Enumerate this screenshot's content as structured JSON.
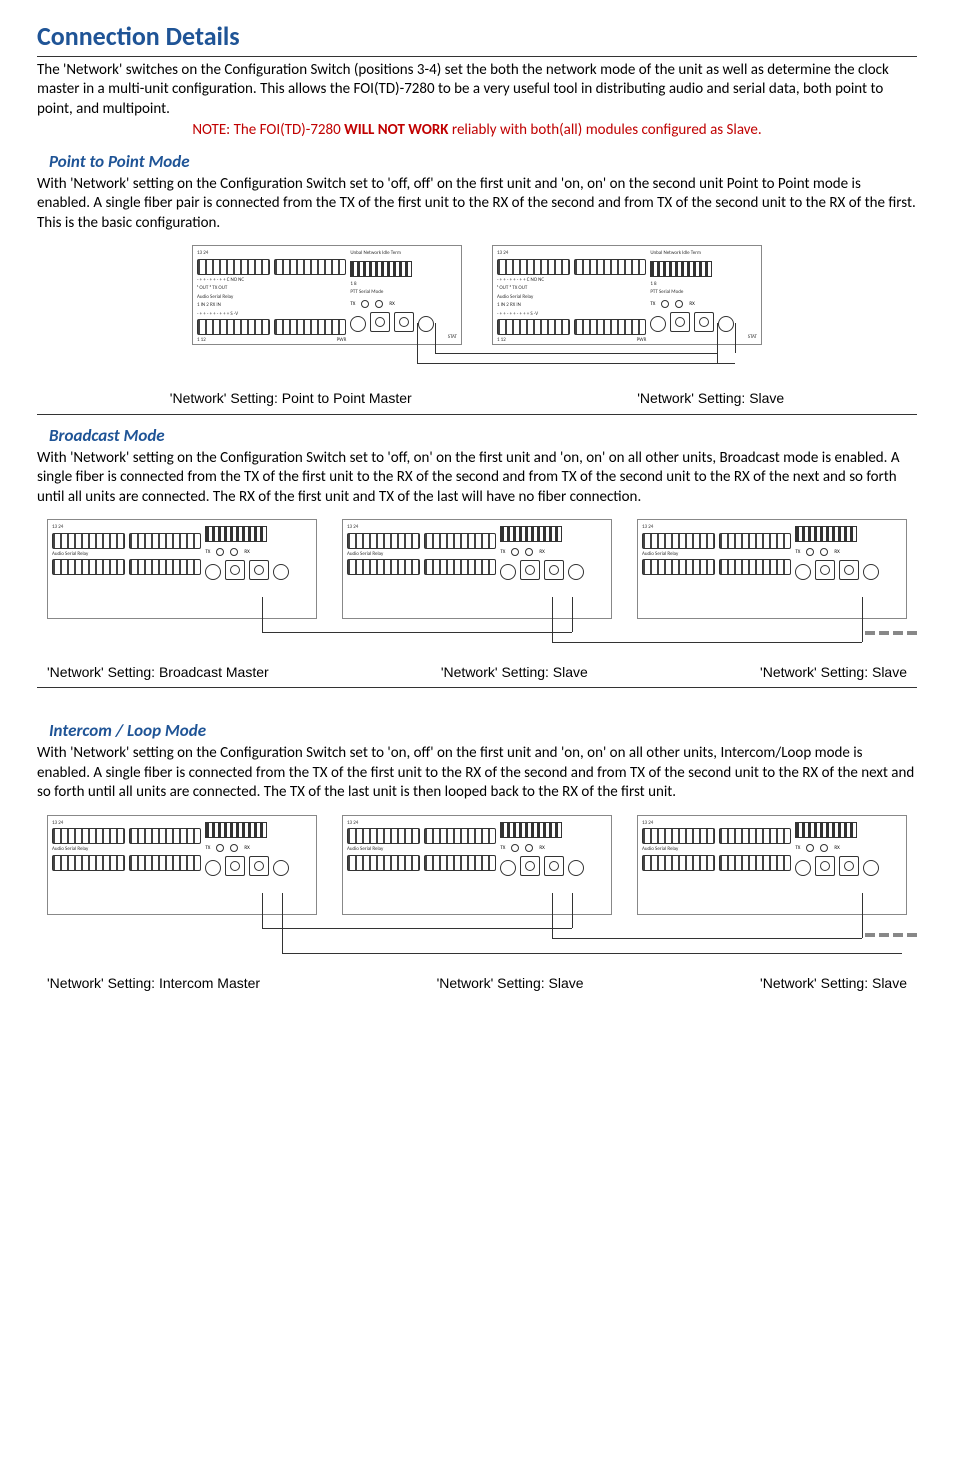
{
  "title": "Connection Details",
  "intro1": "The 'Network' switches on the Configuration Switch (positions 3-4) set the both the network mode of the unit as well as determine the clock master in a multi-unit configuration. This allows the FOI(TD)-7280 to be a very useful tool in distributing audio and serial data, both point to point, and multipoint.",
  "note_prefix": "NOTE: The FOI(TD)-7280 ",
  "note_bold": "WILL NOT WORK",
  "note_suffix": " reliably with both(all) modules configured as Slave.",
  "sections": {
    "ptp": {
      "heading": "Point to Point Mode",
      "body": "With 'Network' setting on the Configuration Switch set to 'off, off' on the first unit and 'on, on' on the second unit Point to Point mode is enabled. A single fiber pair is connected from the TX of the first unit to the RX of the second and from TX of the second unit to the RX of the first. This is the basic configuration.",
      "caption1": "'Network' Setting: Point to Point Master",
      "caption2": "'Network' Setting: Slave"
    },
    "broadcast": {
      "heading": "Broadcast Mode",
      "body": "With 'Network' setting on the Configuration Switch set to 'off, on' on the first unit and 'on, on' on all other units, Broadcast mode is enabled. A single fiber is connected from the TX of the first unit to the RX of the second and from TX of the second unit to the RX of the next and so forth until all units are connected. The RX of the first unit and TX of the last will have no fiber connection.",
      "caption1": "'Network' Setting: Broadcast Master",
      "caption2": "'Network' Setting: Slave",
      "caption3": "'Network' Setting: Slave"
    },
    "intercom": {
      "heading": "Intercom / Loop Mode",
      "body": "With 'Network' setting on the Configuration Switch set to 'on, off' on the first unit and 'on, on' on all other units, Intercom/Loop mode is enabled. A single fiber is connected from the TX of the first unit to the RX of the second and from TX of the second unit to the RX of the next and so forth until all units are connected. The TX of the last unit is then looped back to the RX of the first unit.",
      "caption1": "'Network' Setting: Intercom Master",
      "caption2": "'Network' Setting: Slave",
      "caption3": "'Network' Setting: Slave"
    }
  },
  "unit_labels": {
    "top_nums": "13                                  24",
    "top_right": "Unbal  Network       Idle  Term",
    "pins_symbols": "- + + - + +      - + + C NO NC",
    "out_tx": "¹ OUT ²          TX         OUT",
    "dip_nums": "1                           8",
    "ptt_serial": "PTT      Serial Mode",
    "audio_relay": "Audio       Serial Relay",
    "tx_rx_led": "TX           RX",
    "in_rx": "1   IN   2         RX          IN",
    "bot_symbols": "- + + - + +     - + + + S -V",
    "bot_nums": "1                                   12",
    "pwr": "PWR",
    "stat": "STAT"
  }
}
